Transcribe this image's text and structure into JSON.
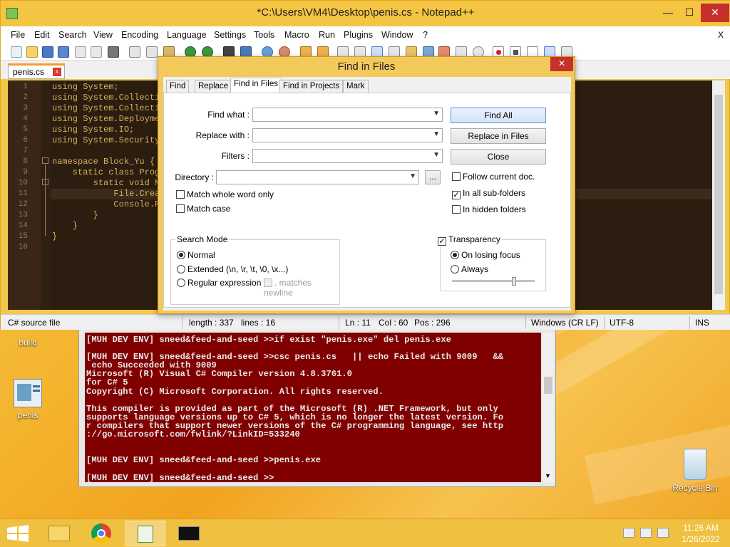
{
  "npp": {
    "title": "*C:\\Users\\VM4\\Desktop\\penis.cs - Notepad++",
    "win_min": "—",
    "win_max": "☐",
    "win_close": "✕",
    "menu": [
      "File",
      "Edit",
      "Search",
      "View",
      "Encoding",
      "Language",
      "Settings",
      "Tools",
      "Macro",
      "Run",
      "Plugins",
      "Window",
      "?"
    ],
    "menu_close": "X",
    "tab_label": "penis.cs",
    "tab_close": "x",
    "line_numbers": [
      "1",
      "2",
      "3",
      "4",
      "5",
      "6",
      "7",
      "8",
      "9",
      "10",
      "11",
      "12",
      "13",
      "14",
      "15",
      "16"
    ],
    "code_lines": [
      "using System;",
      "using System.Collecti",
      "using System.Collecti",
      "using System.Deploymen",
      "using System.IO;",
      "using System.Security",
      "",
      "namespace Block_Yu {",
      "    static class Progr",
      "        static void Ma",
      "            File.Creat",
      "            Console.Re",
      "        }",
      "    }",
      "}",
      ""
    ],
    "status": {
      "filetype": "C# source file",
      "length": "length : 337",
      "lines": "lines : 16",
      "ln": "Ln : 11",
      "col": "Col : 60",
      "pos": "Pos : 296",
      "eol": "Windows (CR LF)",
      "encoding": "UTF-8",
      "mode": "INS"
    }
  },
  "find": {
    "title": "Find in Files",
    "close": "✕",
    "tabs": [
      "Find",
      "Replace",
      "Find in Files",
      "Find in Projects",
      "Mark"
    ],
    "labels": {
      "find_what": "Find what :",
      "replace_with": "Replace with :",
      "filters": "Filters :",
      "directory": "Directory :"
    },
    "browse": "...",
    "buttons": {
      "find_all": "Find All",
      "replace_in_files": "Replace in Files",
      "close": "Close"
    },
    "checks": {
      "follow_current": "Follow current doc.",
      "all_subfolders": "In all sub-folders",
      "hidden_folders": "In hidden folders",
      "whole_word": "Match whole word only",
      "match_case": "Match case",
      "transparency": "Transparency",
      "matches_newline": ". matches newline"
    },
    "search_mode": {
      "title": "Search Mode",
      "normal": "Normal",
      "extended": "Extended (\\n, \\r, \\t, \\0, \\x...)",
      "regex": "Regular expression"
    },
    "transparency_mode": {
      "on_losing_focus": "On losing focus",
      "always": "Always"
    },
    "slider_level": 0.75
  },
  "console": {
    "lines": [
      "[MUH DEV ENV] sneed&feed-and-seed >>if exist \"penis.exe\" del penis.exe",
      "",
      "[MUH DEV ENV] sneed&feed-and-seed >>csc penis.cs   || echo Failed with 9009   &&",
      " echo Succeeded with 9009",
      "Microsoft (R) Visual C# Compiler version 4.8.3761.0",
      "for C# 5",
      "Copyright (C) Microsoft Corporation. All rights reserved.",
      "",
      "This compiler is provided as part of the Microsoft (R) .NET Framework, but only",
      "supports language versions up to C# 5, which is no longer the latest version. Fo",
      "r compilers that support newer versions of the C# programming language, see http",
      "://go.microsoft.com/fwlink/?LinkID=533240",
      "",
      "",
      "[MUH DEV ENV] sneed&feed-and-seed >>penis.exe",
      "",
      "[MUH DEV ENV] sneed&feed-and-seed >>"
    ]
  },
  "desktop": {
    "icon_build": "build",
    "icon_penis": "penis",
    "icon_recycle": "Recycle Bin"
  },
  "taskbar": {
    "time": "11:26 AM",
    "date": "1/26/2022"
  }
}
